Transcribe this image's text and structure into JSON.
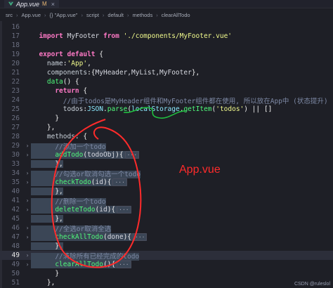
{
  "tab": {
    "title": "App.vue",
    "modified": "M",
    "close": "×"
  },
  "breadcrumb": [
    "src",
    "App.vue",
    "{} \"App.vue\"",
    "script",
    "default",
    "methods",
    "clearAllTodo"
  ],
  "lines": [
    {
      "n": "16",
      "segments": []
    },
    {
      "n": "17",
      "segments": [
        {
          "c": "kw",
          "t": "  import "
        },
        {
          "c": "plain",
          "t": "MyFooter "
        },
        {
          "c": "kw",
          "t": "from "
        },
        {
          "c": "str",
          "t": "'./components/MyFooter.vue'"
        }
      ]
    },
    {
      "n": "18",
      "segments": []
    },
    {
      "n": "19",
      "segments": [
        {
          "c": "kw",
          "t": "  export default "
        },
        {
          "c": "punc",
          "t": "{"
        }
      ]
    },
    {
      "n": "20",
      "segments": [
        {
          "c": "prop",
          "t": "    name"
        },
        {
          "c": "punc",
          "t": ":"
        },
        {
          "c": "str",
          "t": "'App'"
        },
        {
          "c": "punc",
          "t": ","
        }
      ]
    },
    {
      "n": "21",
      "segments": [
        {
          "c": "prop",
          "t": "    components"
        },
        {
          "c": "punc",
          "t": ":{"
        },
        {
          "c": "plain",
          "t": "MyHeader,MyList,MyFooter"
        },
        {
          "c": "punc",
          "t": "},"
        }
      ]
    },
    {
      "n": "22",
      "segments": [
        {
          "c": "fn",
          "t": "    data"
        },
        {
          "c": "punc",
          "t": "() {"
        }
      ]
    },
    {
      "n": "23",
      "segments": [
        {
          "c": "kw",
          "t": "      return "
        },
        {
          "c": "punc",
          "t": "{"
        }
      ]
    },
    {
      "n": "24",
      "segments": [
        {
          "c": "cm",
          "t": "        //由于todos是MyHeader组件和MyFooter组件都在使用, 所以放在App中 (状态提升)"
        }
      ]
    },
    {
      "n": "25",
      "segments": [
        {
          "c": "prop",
          "t": "        todos"
        },
        {
          "c": "punc",
          "t": ":"
        },
        {
          "c": "obj",
          "t": "JSON"
        },
        {
          "c": "punc",
          "t": "."
        },
        {
          "c": "fn",
          "t": "parse"
        },
        {
          "c": "punc",
          "t": "("
        },
        {
          "c": "obj",
          "t": "localStorage"
        },
        {
          "c": "punc",
          "t": "."
        },
        {
          "c": "fn",
          "t": "getItem"
        },
        {
          "c": "punc",
          "t": "("
        },
        {
          "c": "str",
          "t": "'todos'"
        },
        {
          "c": "punc",
          "t": ") || []"
        }
      ]
    },
    {
      "n": "26",
      "segments": [
        {
          "c": "punc",
          "t": "      }"
        }
      ]
    },
    {
      "n": "27",
      "segments": [
        {
          "c": "punc",
          "t": "    },"
        }
      ]
    },
    {
      "n": "28",
      "segments": [
        {
          "c": "prop",
          "t": "    methods"
        },
        {
          "c": "punc",
          "t": ": {"
        }
      ]
    },
    {
      "n": "29",
      "fold": "›",
      "sel": true,
      "segments": [
        {
          "c": "cm",
          "t": "      //添加一个todo"
        }
      ]
    },
    {
      "n": "30",
      "fold": "›",
      "sel": true,
      "segments": [
        {
          "c": "fn",
          "t": "      addTodo"
        },
        {
          "c": "punc",
          "t": "("
        },
        {
          "c": "plain",
          "t": "todoObj"
        },
        {
          "c": "punc",
          "t": "){"
        }
      ],
      "ellipsis": "···"
    },
    {
      "n": "33",
      "sel": true,
      "segments": [
        {
          "c": "punc",
          "t": "      },"
        }
      ]
    },
    {
      "n": "34",
      "fold": "›",
      "sel": true,
      "segments": [
        {
          "c": "cm",
          "t": "      //勾选or取消勾选一个todo"
        }
      ]
    },
    {
      "n": "35",
      "fold": "›",
      "sel": true,
      "segments": [
        {
          "c": "fn",
          "t": "      checkTodo"
        },
        {
          "c": "punc",
          "t": "("
        },
        {
          "c": "plain",
          "t": "id"
        },
        {
          "c": "punc",
          "t": "){"
        }
      ],
      "ellipsis": "···"
    },
    {
      "n": "40",
      "sel": true,
      "segments": [
        {
          "c": "punc",
          "t": "      },"
        }
      ]
    },
    {
      "n": "41",
      "fold": "›",
      "sel": true,
      "segments": [
        {
          "c": "cm",
          "t": "      //删除一个todo"
        }
      ]
    },
    {
      "n": "42",
      "fold": "›",
      "sel": true,
      "segments": [
        {
          "c": "fn",
          "t": "      deleteTodo"
        },
        {
          "c": "punc",
          "t": "("
        },
        {
          "c": "plain",
          "t": "id"
        },
        {
          "c": "punc",
          "t": "){"
        }
      ],
      "ellipsis": "···"
    },
    {
      "n": "45",
      "sel": true,
      "segments": [
        {
          "c": "punc",
          "t": "      },"
        }
      ]
    },
    {
      "n": "46",
      "fold": "›",
      "sel": true,
      "segments": [
        {
          "c": "cm",
          "t": "      //全选or取消全选"
        }
      ]
    },
    {
      "n": "47",
      "fold": "›",
      "sel": true,
      "segments": [
        {
          "c": "fn",
          "t": "      checkAllTodo"
        },
        {
          "c": "punc",
          "t": "("
        },
        {
          "c": "plain",
          "t": "done"
        },
        {
          "c": "punc",
          "t": "){"
        }
      ],
      "ellipsis": "···"
    },
    {
      "n": "48",
      "sel": true,
      "segments": [
        {
          "c": "punc",
          "t": "      },"
        }
      ]
    },
    {
      "n": "49",
      "fold": "›",
      "sel": true,
      "active": true,
      "segments": [
        {
          "c": "cm",
          "t": "      //清除所有已经完成的todo"
        }
      ]
    },
    {
      "n": "49",
      "fold": "›",
      "sel": true,
      "segments": [
        {
          "c": "fn",
          "t": "      clearAllTodo"
        },
        {
          "c": "punc",
          "t": "(){"
        }
      ],
      "ellipsis": "···"
    },
    {
      "n": "50",
      "segments": [
        {
          "c": "punc",
          "t": "      }"
        }
      ]
    },
    {
      "n": "51",
      "segments": [
        {
          "c": "punc",
          "t": "    },"
        }
      ]
    }
  ],
  "annotation": "App.vue",
  "watermark": "CSDN @ruleslol",
  "colors": {
    "annotation_ink": "#ff2b2b",
    "green_ink": "#20c040"
  }
}
